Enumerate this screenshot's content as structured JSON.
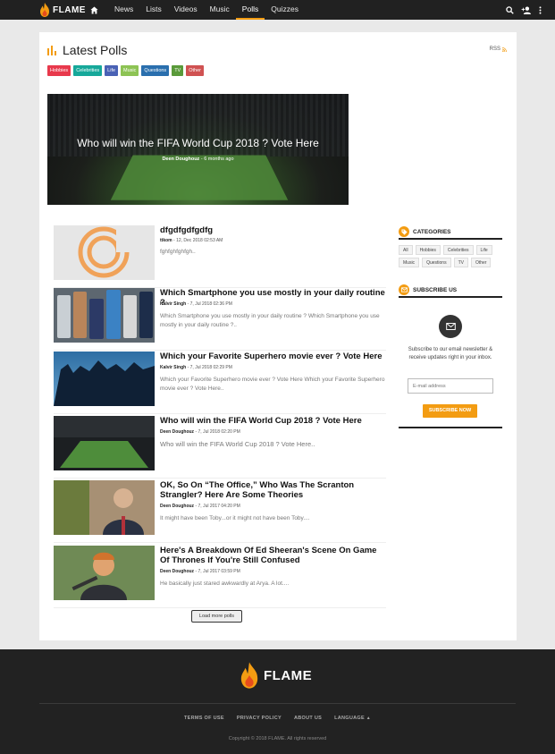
{
  "brand": {
    "name": "FLAME",
    "accent": "#f39c12"
  },
  "nav": {
    "items": [
      "News",
      "Lists",
      "Videos",
      "Music",
      "Polls",
      "Quizzes"
    ],
    "active": "Polls"
  },
  "page": {
    "title": "Latest Polls",
    "rss_label": "RSS"
  },
  "tags": [
    {
      "label": "Hobbies",
      "color": "#e8394c"
    },
    {
      "label": "Celebrities",
      "color": "#16a89a"
    },
    {
      "label": "Life",
      "color": "#4a62b5"
    },
    {
      "label": "Music",
      "color": "#8dc354"
    },
    {
      "label": "Questions",
      "color": "#2a6fae"
    },
    {
      "label": "TV",
      "color": "#5a9a3a"
    },
    {
      "label": "Other",
      "color": "#d05252"
    }
  ],
  "hero": {
    "title": "Who will win the FIFA World Cup 2018 ? Vote Here",
    "author": "Deen Doughouz",
    "time": "6 months ago"
  },
  "polls": [
    {
      "title": "dfgdfgdfgdfg",
      "author": "ttkom",
      "date": "12, Dec 2018 02:53 AM",
      "desc": "fghfghfghfgh..",
      "thumb": "logo"
    },
    {
      "title": "Which Smartphone you use mostly in your daily routine ?",
      "author": "Kalvir Singh",
      "date": "7, Jul 2018 02:36 PM",
      "desc": "Which Smartphone you use mostly in your daily routine ? Which Smartphone you use mostly in your daily routine ?..",
      "thumb": "phones"
    },
    {
      "title": "Which your Favorite Superhero movie ever ? Vote Here",
      "author": "Kalvir Singh",
      "date": "7, Jul 2018 02:29 PM",
      "desc": "Which your Favorite Superhero movie ever ? Vote Here Which your Favorite Superhero movie ever ? Vote Here..",
      "thumb": "heroes"
    },
    {
      "title": "Who will win the FIFA World Cup 2018 ? Vote Here",
      "author": "Deen Doughouz",
      "date": "7, Jul 2018 02:20 PM",
      "desc": "Who will win the FIFA World Cup 2018 ? Vote Here..",
      "thumb": "stadium"
    },
    {
      "title": "OK, So On “The Office,” Who Was The Scranton Strangler? Here Are Some Theories",
      "author": "Deen Doughouz",
      "date": "7, Jul 2017 04:20 PM",
      "desc": "It might have been Toby...or it might not have been Toby....",
      "thumb": "office"
    },
    {
      "title": "Here's A Breakdown Of Ed Sheeran's Scene On Game Of Thrones If You're Still Confused",
      "author": "Deen Doughouz",
      "date": "7, Jul 2017 03:59 PM",
      "desc": "He basically just stared awkwardly at Arya. A lot....",
      "thumb": "singer"
    }
  ],
  "load_more": "Load more polls",
  "sidebar": {
    "categories_title": "CATEGORIES",
    "categories": [
      "All",
      "Hobbies",
      "Celebrities",
      "Life",
      "Music",
      "Questions",
      "TV",
      "Other"
    ],
    "subscribe_title": "SUBSCRIBE US",
    "subscribe_text": "Subscribe to our email newsletter & receive updates right in your inbox.",
    "email_placeholder": "E-mail address",
    "subscribe_button": "SUBSCRIBE NOW"
  },
  "footer": {
    "links": [
      "TERMS OF USE",
      "PRIVACY POLICY",
      "ABOUT US",
      "LANGUAGE"
    ],
    "copyright": "Copyright © 2018 FLAME. All rights reserved"
  }
}
